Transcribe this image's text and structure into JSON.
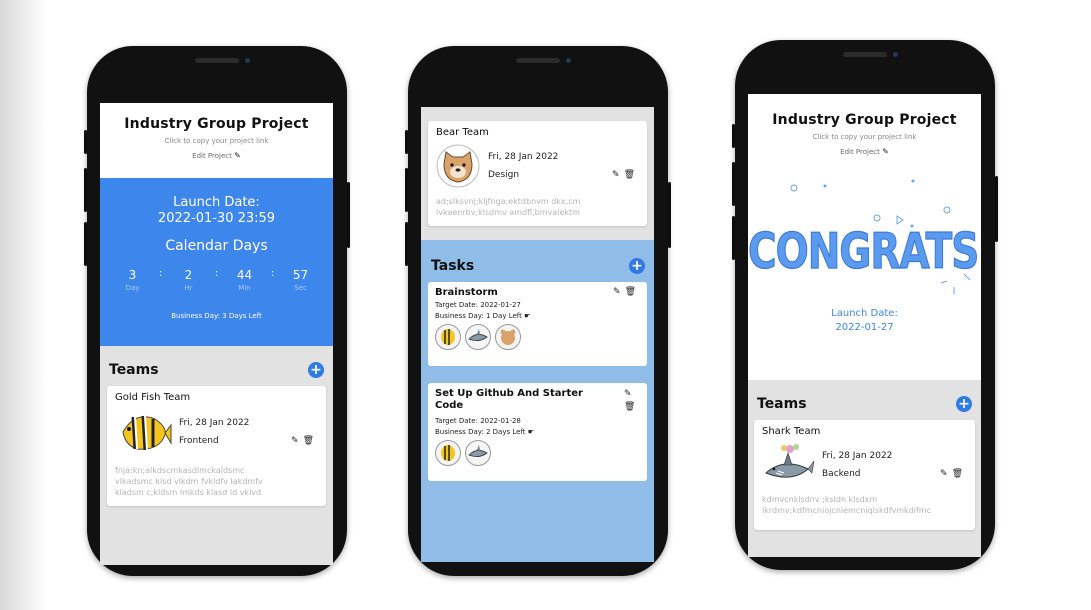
{
  "project": {
    "title": "Industry Group Project",
    "copy_link": "Click to copy your project link",
    "edit_label": "Edit Project"
  },
  "launch": {
    "label": "Launch Date:",
    "datetime": "2022-01-30 23:59",
    "date_short": "2022-01-27",
    "calendar_days_label": "Calendar Days",
    "countdown": [
      {
        "value": "3",
        "label": "Day"
      },
      {
        "value": "2",
        "label": "Hr"
      },
      {
        "value": "44",
        "label": "Min"
      },
      {
        "value": "57",
        "label": "Sec"
      }
    ],
    "business_day": "Business Day: 3 Days Left"
  },
  "teams": {
    "title": "Teams",
    "gold_fish": {
      "name": "Gold Fish Team",
      "date": "Fri, 28 Jan 2022",
      "category": "Frontend",
      "desc_1": "fnja;kn;alkdscmkasdlmckaldsmc",
      "desc_2": "vlkadsmc klsd vlkdm fvkldfv lakdmfv",
      "desc_3": "kladsm c;kldsm lmkds klasd ld vklvd"
    },
    "bear": {
      "name": "Bear Team",
      "date": "Fri, 28 Jan 2022",
      "category": "Design",
      "desc_1": "ad;slksvnj;kljfnga;ektdbnvm dkx,cm",
      "desc_2": "lvkaenrbv;klsdmv amdfl,bmvalektm"
    },
    "shark": {
      "name": "Shark Team",
      "date": "Fri, 28 Jan 2022",
      "category": "Backend",
      "desc_1": "kdmvcnklsdnv ;ksldn klsdxm",
      "desc_2": "lkrdmv;kdfmcniojcniemcniqiskdfvmkdifmc"
    }
  },
  "tasks": {
    "title": "Tasks",
    "items": [
      {
        "title": "Brainstorm",
        "target": "Target Date: 2022-01-27",
        "business": "Business Day: 1 Day Left"
      },
      {
        "title": "Set Up Github And Starter Code",
        "target": "Target Date: 2022-01-28",
        "business": "Business Day: 2 Days Left"
      }
    ]
  },
  "congrats": {
    "text": "CONGRATS!"
  },
  "colors": {
    "primary_blue": "#3d86ec",
    "tasks_blue": "#8fbde8",
    "section_gray": "#e2e2e2",
    "congrats_blue": "#5b9bef"
  },
  "icons": [
    "pencil-icon",
    "trash-icon",
    "plus-icon",
    "gold-fish-avatar",
    "bear-avatar",
    "shark-avatar",
    "pointing-hand-icon"
  ]
}
